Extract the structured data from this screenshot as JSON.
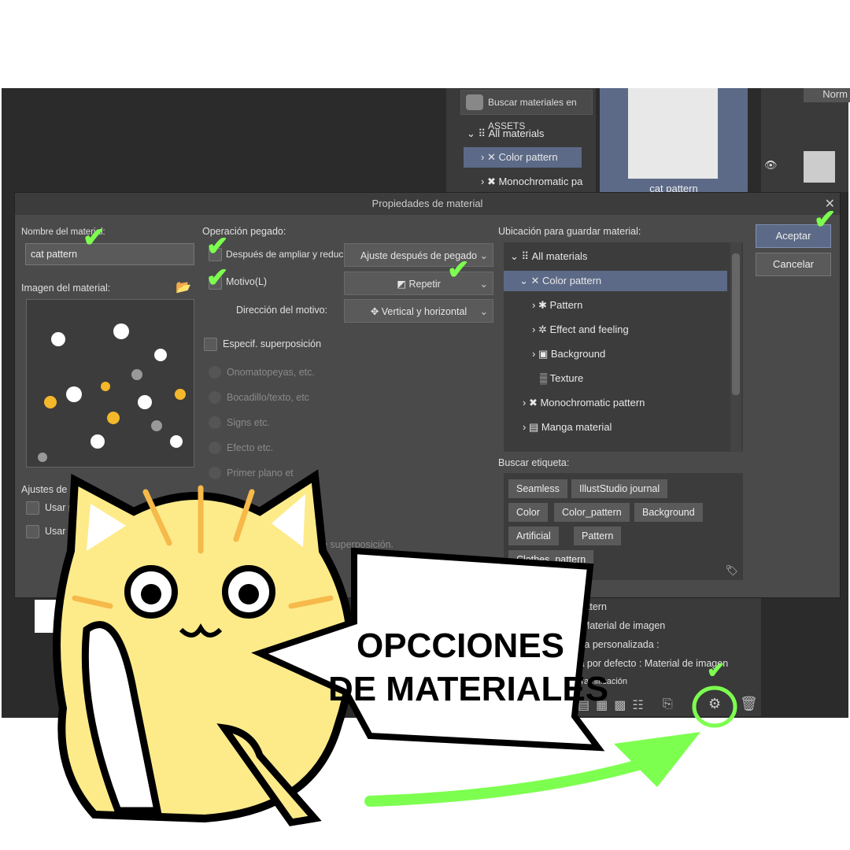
{
  "background_panel": {
    "search_assets": "Buscar materiales en ASSETS",
    "tree": [
      {
        "label": "All materials"
      },
      {
        "label": "Color pattern"
      },
      {
        "label": "Monochromatic pa"
      }
    ],
    "preview_label": "cat pattern",
    "blend_mode": "Norm"
  },
  "info_panel": {
    "lines": [
      "pattern",
      ": Material de imagen",
      "eta personalizada :",
      "ta por defecto : Material de imagen",
      "Tramificación"
    ]
  },
  "dialog": {
    "title": "Propiedades de material",
    "name_label": "Nombre del material:",
    "name_value": "cat pattern",
    "image_label": "Imagen del material:",
    "paste_label": "Operación pegado:",
    "after_scale_label": "Después de ampliar y reducir",
    "after_scale_value": "Ajuste después de pegado",
    "tile_label": "Motivo(L)",
    "tile_value": "Repetir",
    "direction_label": "Dirección del motivo:",
    "direction_value": "Vertical y horizontal",
    "overlay_label": "Especif. superposición",
    "overlay_options": [
      "Onomatopeyas, etc.",
      "Bocadillo/texto, etc",
      "Signs etc.",
      "Efecto etc.",
      "Primer plano et"
    ],
    "overlay_note": "e superposición.",
    "adjust_label": "Ajustes de m",
    "adjust_options": [
      "Usar p",
      "Usar c"
    ],
    "location_label": "Ubicación para guardar material:",
    "location_tree": [
      {
        "label": "All materials",
        "level": 0,
        "expanded": true
      },
      {
        "label": "Color pattern",
        "level": 1,
        "expanded": true,
        "selected": true
      },
      {
        "label": "Pattern",
        "level": 2
      },
      {
        "label": "Effect and feeling",
        "level": 2
      },
      {
        "label": "Background",
        "level": 2
      },
      {
        "label": "Texture",
        "level": 2
      },
      {
        "label": "Monochromatic pattern",
        "level": 1
      },
      {
        "label": "Manga material",
        "level": 1
      }
    ],
    "tags_label": "Buscar etiqueta:",
    "tags": [
      "Seamless",
      "IllustStudio journal",
      "Color",
      "Color_pattern",
      "Background",
      "Artificial",
      "Pattern",
      "Clothes_pattern"
    ],
    "ok": "Aceptar",
    "cancel": "Cancelar",
    "checked": {
      "after_scale": true,
      "tile": true,
      "overlay": false
    }
  },
  "overlay": {
    "caption_line1": "OPCCIONES",
    "caption_line2": "DE MATERIALES",
    "accent": "#7dff4f"
  }
}
